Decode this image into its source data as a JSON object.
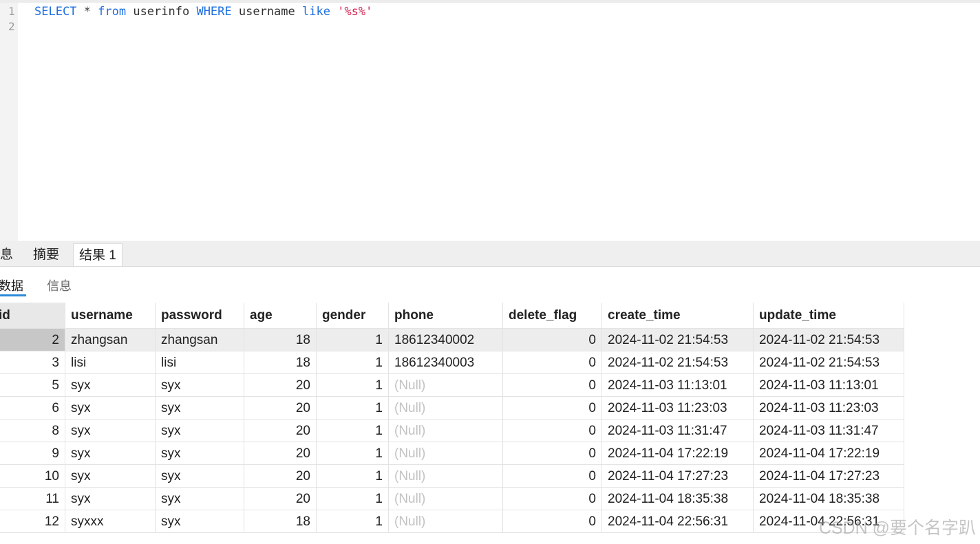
{
  "editor": {
    "lines": [
      {
        "num": "1",
        "tokens": [
          {
            "t": "SELECT",
            "c": "kw"
          },
          {
            "t": " * ",
            "c": "plain"
          },
          {
            "t": "from",
            "c": "kw"
          },
          {
            "t": " userinfo ",
            "c": "plain"
          },
          {
            "t": "WHERE",
            "c": "kw"
          },
          {
            "t": " username ",
            "c": "plain"
          },
          {
            "t": "like",
            "c": "kw"
          },
          {
            "t": " ",
            "c": "plain"
          },
          {
            "t": "'%s%'",
            "c": "str"
          }
        ]
      },
      {
        "num": "2",
        "tokens": []
      }
    ]
  },
  "tabs": [
    "息",
    "摘要",
    "结果 1"
  ],
  "active_tab": "结果 1",
  "subtabs": [
    "数据",
    "信息"
  ],
  "grid": {
    "columns": [
      "id",
      "username",
      "password",
      "age",
      "gender",
      "phone",
      "delete_flag",
      "create_time",
      "update_time"
    ],
    "rows": [
      [
        "2",
        "zhangsan",
        "zhangsan",
        "18",
        "1",
        "18612340002",
        "0",
        "2024-11-02 21:54:53",
        "2024-11-02 21:54:53"
      ],
      [
        "3",
        "lisi",
        "lisi",
        "18",
        "1",
        "18612340003",
        "0",
        "2024-11-02 21:54:53",
        "2024-11-02 21:54:53"
      ],
      [
        "5",
        "syx",
        "syx",
        "20",
        "1",
        "(Null)",
        "0",
        "2024-11-03 11:13:01",
        "2024-11-03 11:13:01"
      ],
      [
        "6",
        "syx",
        "syx",
        "20",
        "1",
        "(Null)",
        "0",
        "2024-11-03 11:23:03",
        "2024-11-03 11:23:03"
      ],
      [
        "8",
        "syx",
        "syx",
        "20",
        "1",
        "(Null)",
        "0",
        "2024-11-03 11:31:47",
        "2024-11-03 11:31:47"
      ],
      [
        "9",
        "syx",
        "syx",
        "20",
        "1",
        "(Null)",
        "0",
        "2024-11-04 17:22:19",
        "2024-11-04 17:22:19"
      ],
      [
        "10",
        "syx",
        "syx",
        "20",
        "1",
        "(Null)",
        "0",
        "2024-11-04 17:27:23",
        "2024-11-04 17:27:23"
      ],
      [
        "11",
        "syx",
        "syx",
        "20",
        "1",
        "(Null)",
        "0",
        "2024-11-04 18:35:38",
        "2024-11-04 18:35:38"
      ],
      [
        "12",
        "syxxx",
        "syx",
        "18",
        "1",
        "(Null)",
        "0",
        "2024-11-04 22:56:31",
        "2024-11-04 22:56:31"
      ]
    ],
    "selected_row_index": 0
  },
  "watermark": "CSDN @要个名字趴",
  "colors": {
    "keyword": "#1e6fe0",
    "string": "#d6204e",
    "null": "#c2c2c2",
    "tab_underline": "#2b8ad8"
  }
}
